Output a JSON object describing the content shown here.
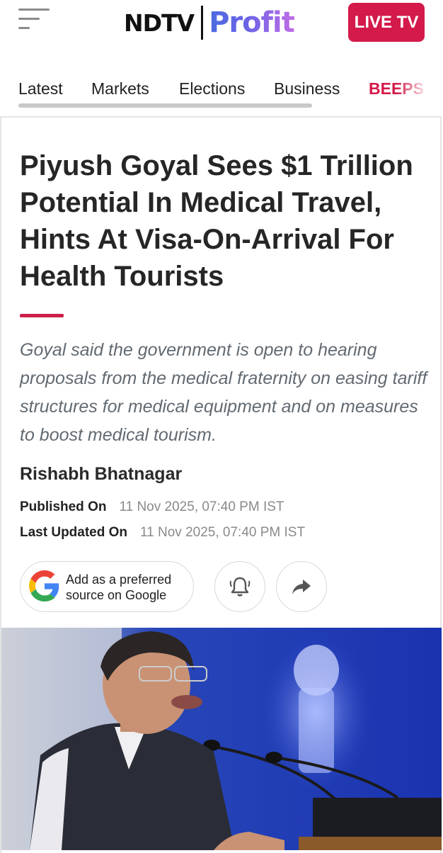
{
  "header": {
    "logo_ndtv": "NDTV",
    "logo_profit": "Profit",
    "live_tv_label": "LIVE TV"
  },
  "nav": {
    "tabs": [
      {
        "label": "Latest"
      },
      {
        "label": "Markets"
      },
      {
        "label": "Elections"
      },
      {
        "label": "Business"
      },
      {
        "label": "BEEPS"
      }
    ]
  },
  "article": {
    "headline": "Piyush Goyal Sees $1 Trillion Potential In Medical Travel, Hints At Visa-On-Arrival For Health Tourists",
    "summary": "Goyal said the government is open to hearing proposals from the medical fraternity on easing tariff structures for medical equipment and on measures to boost medical tourism.",
    "author": "Rishabh Bhatnagar",
    "published_label": "Published On",
    "published_value": "11 Nov 2025, 07:40 PM IST",
    "updated_label": "Last Updated On",
    "updated_value": "11 Nov 2025, 07:40 PM IST"
  },
  "actions": {
    "preferred_line1": "Add as a preferred",
    "preferred_line2": "source on Google",
    "bell_icon": "bell-icon",
    "share_icon": "share-icon"
  },
  "colors": {
    "accent": "#d31a4a",
    "profit_gradient_start": "#4b6be0",
    "profit_gradient_end": "#c06ce6"
  }
}
